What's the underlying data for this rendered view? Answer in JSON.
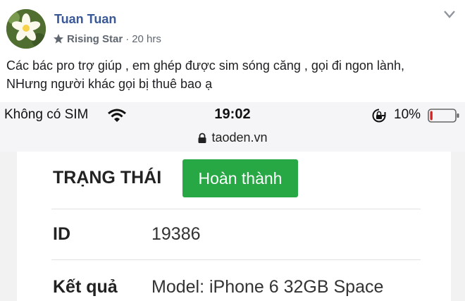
{
  "post": {
    "author": "Tuan Tuan",
    "badge": "Rising Star",
    "separator": "·",
    "time": "20 hrs",
    "text_line1": "Các bác pro trợ giúp , em ghép được sim sóng căng , gọi đi ngon lành,",
    "text_line2": "NHưng người khác gọi bị thuê bao ạ",
    "icons": [
      "avatar-flower",
      "star-icon",
      "chevron-down-icon"
    ]
  },
  "phone": {
    "carrier": "Không có SIM",
    "time": "19:02",
    "battery": "10%",
    "battery_level": 0.1,
    "url": "taoden.vn",
    "icons": [
      "wifi-icon",
      "rotation-lock-icon",
      "battery-icon",
      "lock-icon"
    ]
  },
  "order": {
    "status_label": "TRẠNG THÁI",
    "status_value": "Hoàn thành",
    "id_label": "ID",
    "id_value": "19386",
    "result_label": "Kết quả",
    "result_value": "Model: iPhone 6 32GB Space"
  },
  "colors": {
    "author_link": "#385898",
    "status_green": "#28a745",
    "battery_red": "#e02020"
  }
}
